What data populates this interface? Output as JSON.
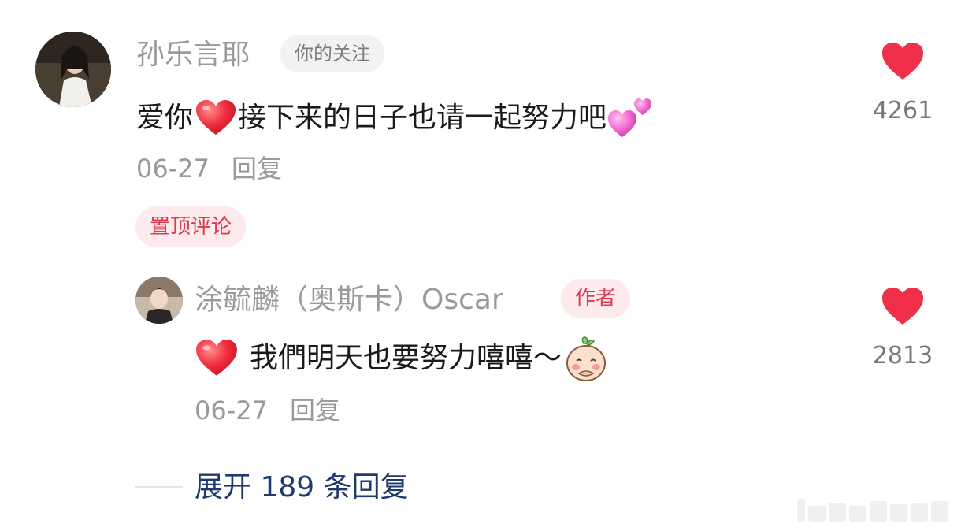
{
  "comment": {
    "username": "孙乐言耶",
    "follow_tag": "你的关注",
    "text_part1": "爱你",
    "text_part2": "接下来的日子也请一起努力吧",
    "date": "06-27",
    "reply_label": "回复",
    "pin_label": "置顶评论",
    "like_count": "4261"
  },
  "reply": {
    "username": "涂毓麟（奥斯卡）Oscar",
    "author_tag": "作者",
    "text": "我們明天也要努力嘻嘻～",
    "date": "06-27",
    "reply_label": "回复",
    "like_count": "2813"
  },
  "expand_label": "展开 189 条回复",
  "colors": {
    "like_red": "#f0304a",
    "expand_blue": "#1f3b6e",
    "tag_red": "#e0394f"
  },
  "icons": [
    "heart-icon",
    "red-heart-emoji",
    "pink-hearts-emoji",
    "blush-emoji"
  ]
}
